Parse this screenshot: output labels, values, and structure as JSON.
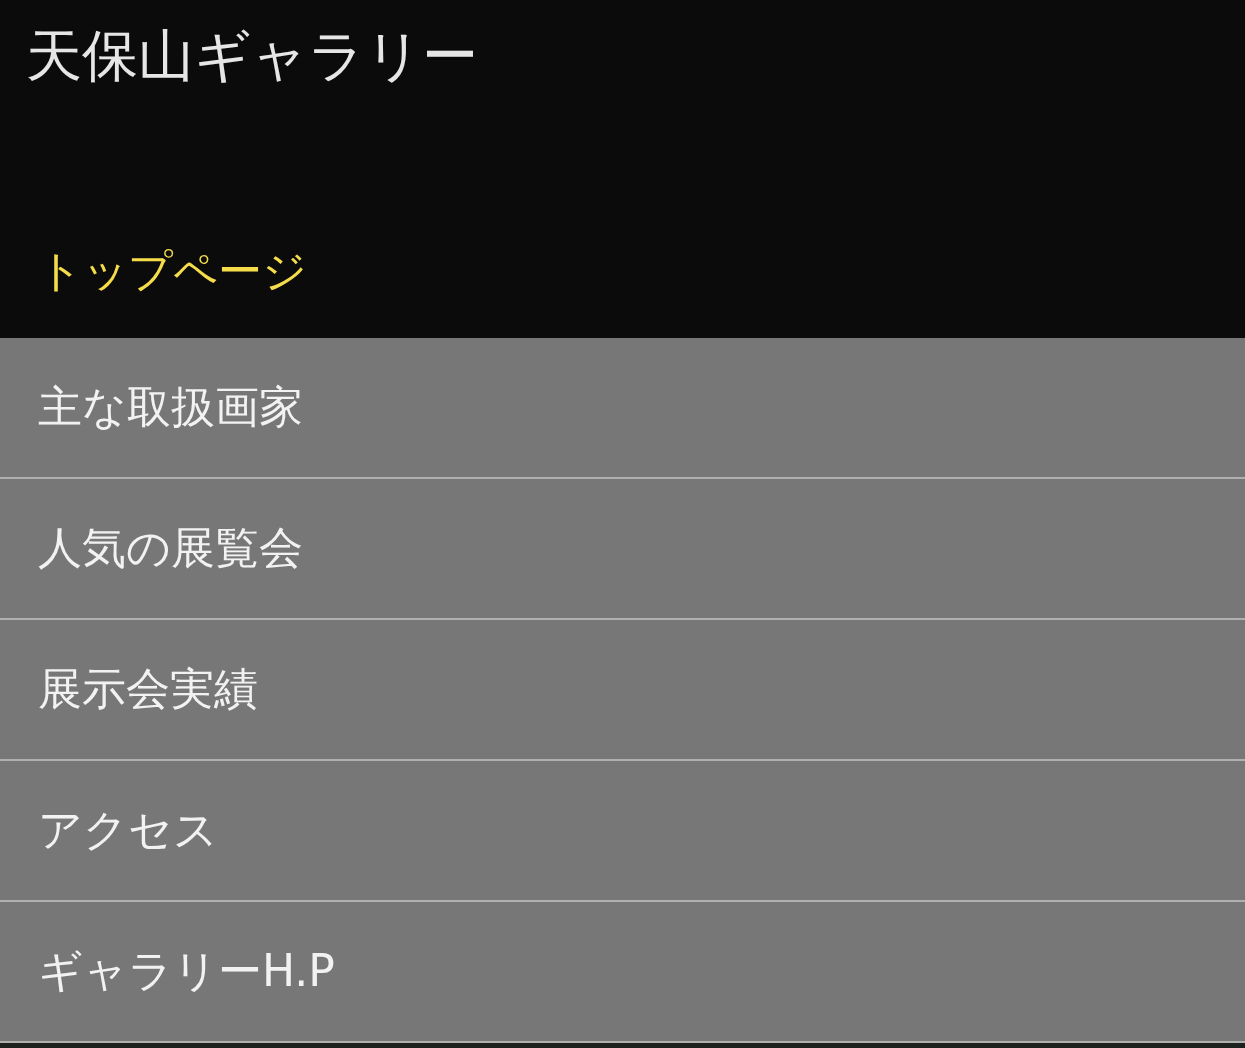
{
  "header": {
    "title": "天保山ギャラリー",
    "current_link": {
      "label": "トップページ",
      "selected": true
    }
  },
  "menu": [
    {
      "label": "主な取扱画家",
      "selected": false
    },
    {
      "label": "人気の展覧会",
      "selected": false
    },
    {
      "label": "展示会実績",
      "selected": false
    },
    {
      "label": "アクセス",
      "selected": false
    },
    {
      "label": "ギャラリーH.P",
      "selected": false
    }
  ]
}
